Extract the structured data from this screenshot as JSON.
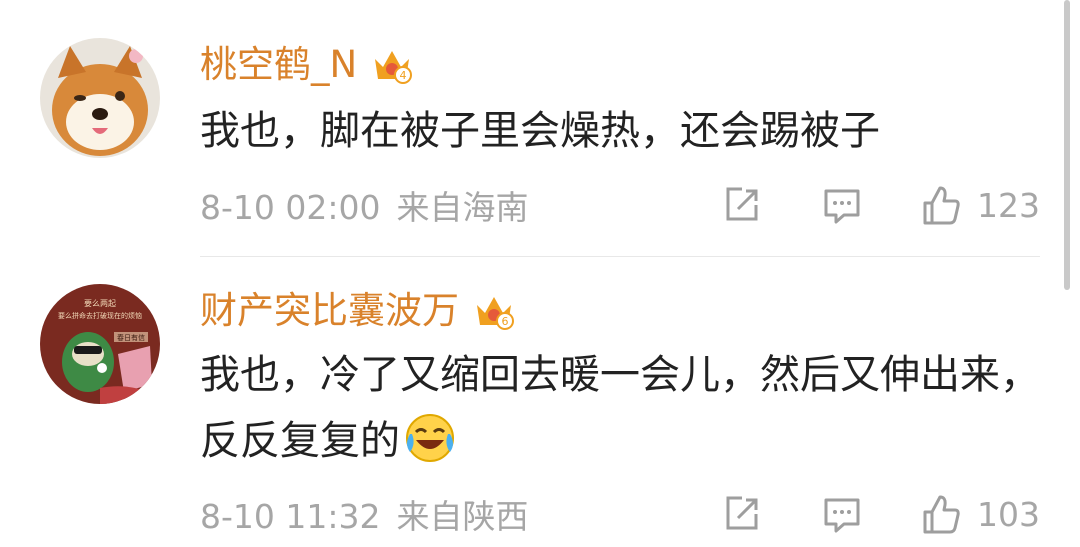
{
  "comments": [
    {
      "username": "桃空鹤_N",
      "badge_level": "4",
      "content": "我也，脚在被子里会燥热，还会踢被子",
      "time": "8-10 02:00",
      "location": "来自海南",
      "likes": "123"
    },
    {
      "username": "财产突比囊波万",
      "badge_level": "6",
      "content": "我也，冷了又缩回去暖一会儿，然后又伸出来，反反复复的",
      "time": "8-10 11:32",
      "location": "来自陕西",
      "likes": "103",
      "avatar_text_top": "要么两起",
      "avatar_text_mid": "要么拼命去打破现在的烦恼",
      "avatar_text_badge": "春日有信"
    }
  ],
  "colors": {
    "username": "#d9822b",
    "content": "#222222",
    "meta": "#a6a6a6",
    "icon": "#9e9e9e",
    "badge": "#f0a020"
  },
  "icons": [
    "crown-badge-icon",
    "share-icon",
    "comment-icon",
    "like-icon",
    "laugh-cry-emoji"
  ]
}
